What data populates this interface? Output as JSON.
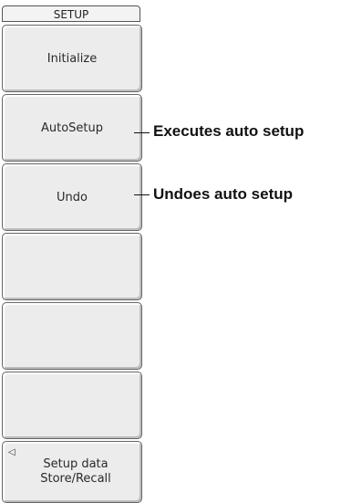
{
  "menu": {
    "title": "SETUP",
    "keys": [
      {
        "label": "Initialize"
      },
      {
        "label": "AutoSetup"
      },
      {
        "label": "Undo"
      },
      {
        "label": ""
      },
      {
        "label": ""
      },
      {
        "label": ""
      },
      {
        "label_line1": "Setup data",
        "label_line2": "Store/Recall",
        "icon": "left-triangle-icon"
      }
    ]
  },
  "annotations": {
    "autosetup": "Executes auto setup",
    "undo": "Undoes auto setup"
  }
}
